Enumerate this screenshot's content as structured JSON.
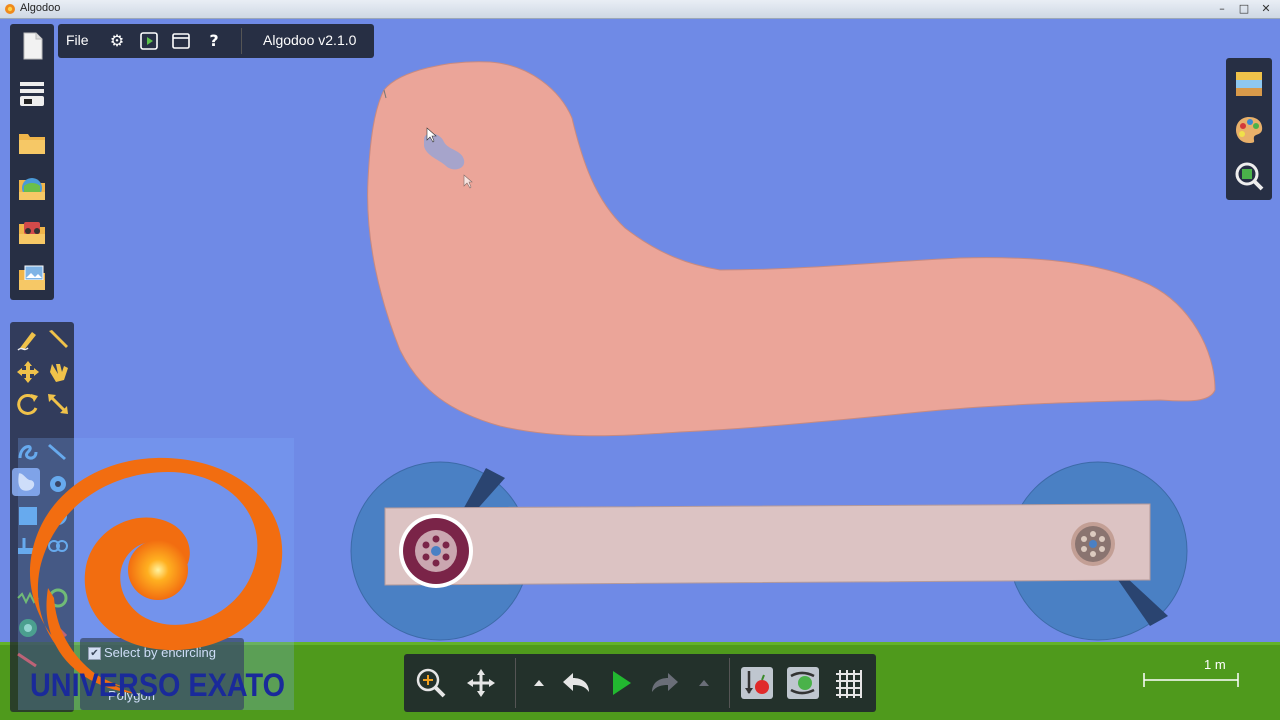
{
  "window": {
    "title": "Algodoo"
  },
  "menu": {
    "file_label": "File",
    "icons": [
      "gear-icon",
      "play-scene-icon",
      "window-icon",
      "help-icon"
    ],
    "settings_glyph": "⚙",
    "help_glyph": "?",
    "version": "Algodoo v2.1.0"
  },
  "left_toolbar": {
    "icons": [
      "new-scene-icon",
      "toolbar-toggle-icon",
      "open-folder-icon",
      "browse-online-icon",
      "scene-folder-icon",
      "image-folder-icon"
    ]
  },
  "right_toolbar": {
    "icons": [
      "background-icon",
      "appearance-palette-icon",
      "zoom-preview-icon"
    ]
  },
  "tools": {
    "icons": [
      "sketch-tool-icon",
      "knife-tool-icon",
      "move-tool-icon",
      "drag-tool-icon",
      "rotate-tool-icon",
      "scale-tool-icon",
      "spring-tool-icon",
      "brush-tool-icon",
      "polygon-tool-icon",
      "gear-tool-icon",
      "box-tool-icon",
      "circle-tool-icon",
      "plane-tool-icon",
      "chain-tool-icon",
      "fixate-tool-icon",
      "hinge-tool-icon",
      "laser-tool-icon",
      "tracer-tool-icon",
      "thruster-tool-icon"
    ]
  },
  "options": {
    "select_by_encircling": "Select by encircling",
    "checked": true,
    "check_glyph": "✔",
    "tool_name": "Polygon"
  },
  "overlay": {
    "logo_text": "UNIVERSO EXATO"
  },
  "bottom_toolbar": {
    "icons": [
      "zoom-icon",
      "pan-icon",
      "speed-up-arrow-icon",
      "undo-icon",
      "play-icon",
      "redo-icon",
      "speed-down-arrow-icon",
      "gravity-icon",
      "air-friction-icon",
      "grid-icon"
    ]
  },
  "scale_indicator": {
    "label": "1 m"
  },
  "colors": {
    "background": "#6f8ae6",
    "ground": "#4f9a1c",
    "body": "#eba599",
    "chassis": "#dcc3c3",
    "wheel": "#4a80c4",
    "toolbar": "#1e222d",
    "accent_orange": "#f26d10"
  }
}
